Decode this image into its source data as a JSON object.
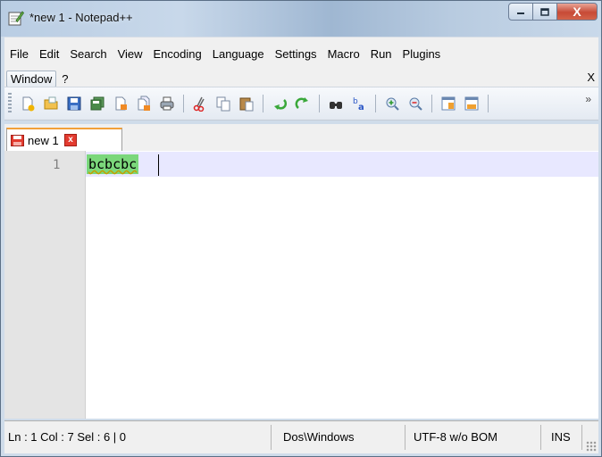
{
  "window": {
    "title": "*new  1 - Notepad++",
    "close_glyph": "X"
  },
  "menu": {
    "row1": [
      "File",
      "Edit",
      "Search",
      "View",
      "Encoding",
      "Language",
      "Settings",
      "Macro",
      "Run",
      "Plugins"
    ],
    "window_label": "Window",
    "help_label": "?",
    "close_doc_label": "X"
  },
  "toolbar": {
    "icons": [
      "new-file-icon",
      "open-file-icon",
      "save-icon",
      "save-all-icon",
      "close-icon",
      "close-all-icon",
      "print-icon",
      "cut-icon",
      "copy-icon",
      "paste-icon",
      "undo-icon",
      "redo-icon",
      "find-icon",
      "replace-icon",
      "zoom-in-icon",
      "zoom-out-icon",
      "sync-vertical-icon",
      "sync-horizontal-icon"
    ],
    "overflow_label": "»"
  },
  "tab": {
    "label": "new  1",
    "close_glyph": "x"
  },
  "editor": {
    "line_number": "1",
    "text": "bcbcbc"
  },
  "status": {
    "position": "Ln : 1    Col : 7    Sel : 6 | 0",
    "eol": "Dos\\Windows",
    "encoding": "UTF-8 w/o BOM",
    "mode": "INS"
  },
  "colors": {
    "selection": "#7bd77b",
    "current_line": "#e8e8ff",
    "tab_accent": "#f2a03a"
  }
}
